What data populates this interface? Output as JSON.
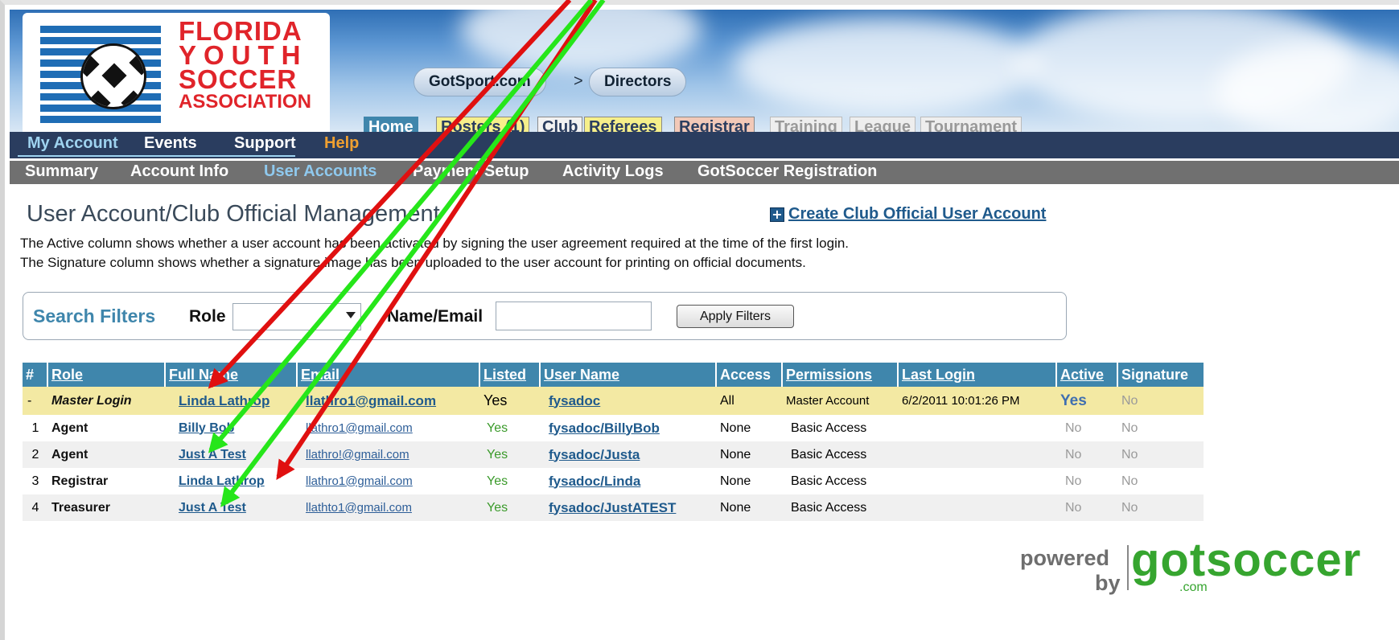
{
  "colors": {
    "header_blue": "#3f86ac",
    "nav_dark": "#2a3d5f",
    "nav_grey": "#707070",
    "master_row": "#f3e9a3",
    "link": "#1f5a8c",
    "arrow_red": "#e01010",
    "arrow_green": "#26e61a"
  },
  "logo": {
    "line1": "FLORIDA",
    "line2": "YOUTH",
    "line3": "SOCCER",
    "line4": "ASSOCIATION"
  },
  "breadcrumb": {
    "site": "GotSport.com",
    "separator": ">",
    "section": "Directors"
  },
  "header_tabs": [
    "Home",
    "Rosters (1)",
    "Club",
    "Referees",
    "Registrar",
    "Training",
    "League",
    "Tournament"
  ],
  "nav_primary": [
    "My Account",
    "Events",
    "Support",
    "Help"
  ],
  "nav_secondary": [
    "Summary",
    "Account Info",
    "User Accounts",
    "Payment Setup",
    "Activity Logs",
    "GotSoccer Registration"
  ],
  "page": {
    "title": "User Account/Club Official Management",
    "create_link": "Create Club Official User Account",
    "create_icon": "plus-box-icon",
    "description_1": "The Active column shows whether a user account has been activated by signing the user agreement required at the time of the first login.",
    "description_2": "The Signature column shows whether a signature image has been uploaded to the user account for printing on official documents."
  },
  "filters": {
    "title": "Search Filters",
    "role_label": "Role",
    "role_value": "",
    "name_label": "Name/Email",
    "name_value": "",
    "apply_label": "Apply Filters"
  },
  "table": {
    "headers": [
      "#",
      "Role",
      "Full Name",
      "Email",
      "Listed",
      "User Name",
      "Access",
      "Permissions",
      "Last Login",
      "Active",
      "Signature"
    ],
    "rows": [
      {
        "num": "-",
        "role": "Master Login",
        "name": "Linda Lathrop",
        "email": "llathro1@gmail.com",
        "listed": "Yes",
        "username": "fysadoc",
        "access": "All",
        "permissions": "Master Account",
        "last_login": "6/2/2011 10:01:26 PM",
        "active": "Yes",
        "signature": "No"
      },
      {
        "num": "1",
        "role": "Agent",
        "name": "Billy Bob",
        "email": "llathro1@gmail.com",
        "listed": "Yes",
        "username": "fysadoc/BillyBob",
        "access": "None",
        "permissions": "Basic Access",
        "last_login": "",
        "active": "No",
        "signature": "No"
      },
      {
        "num": "2",
        "role": "Agent",
        "name": "Just A Test",
        "email": "llathro!@gmail.com",
        "listed": "Yes",
        "username": "fysadoc/Justa",
        "access": "None",
        "permissions": "Basic Access",
        "last_login": "",
        "active": "No",
        "signature": "No"
      },
      {
        "num": "3",
        "role": "Registrar",
        "name": "Linda Lathrop",
        "email": "llathro1@gmail.com",
        "listed": "Yes",
        "username": "fysadoc/Linda",
        "access": "None",
        "permissions": "Basic Access",
        "last_login": "",
        "active": "No",
        "signature": "No"
      },
      {
        "num": "4",
        "role": "Treasurer",
        "name": "Just A Test",
        "email": "llathto1@gmail.com",
        "listed": "Yes",
        "username": "fysadoc/JustATEST",
        "access": "None",
        "permissions": "Basic Access",
        "last_login": "",
        "active": "No",
        "signature": "No"
      }
    ]
  },
  "footer": {
    "powered": "powered",
    "by": "by",
    "brand": "gotsoccer",
    "domain": ".com"
  }
}
